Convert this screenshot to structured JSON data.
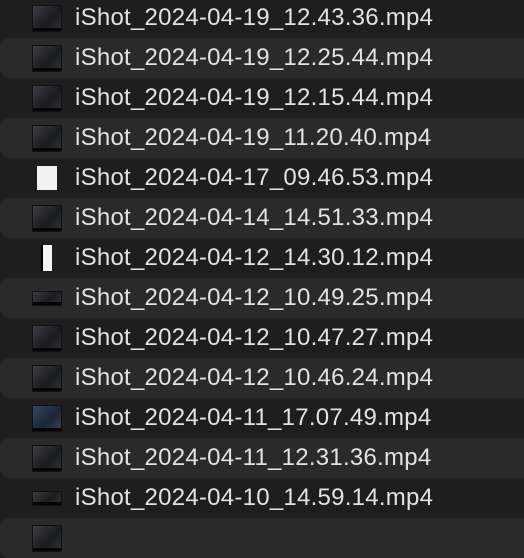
{
  "files": [
    {
      "name": "iShot_2024-04-19_12.43.36.mp4",
      "thumb": "square"
    },
    {
      "name": "iShot_2024-04-19_12.25.44.mp4",
      "thumb": "square"
    },
    {
      "name": "iShot_2024-04-19_12.15.44.mp4",
      "thumb": "square"
    },
    {
      "name": "iShot_2024-04-19_11.20.40.mp4",
      "thumb": "square"
    },
    {
      "name": "iShot_2024-04-17_09.46.53.mp4",
      "thumb": "doc"
    },
    {
      "name": "iShot_2024-04-14_14.51.33.mp4",
      "thumb": "square"
    },
    {
      "name": "iShot_2024-04-12_14.30.12.mp4",
      "thumb": "tall"
    },
    {
      "name": "iShot_2024-04-12_10.49.25.mp4",
      "thumb": "wide"
    },
    {
      "name": "iShot_2024-04-12_10.47.27.mp4",
      "thumb": "square"
    },
    {
      "name": "iShot_2024-04-12_10.46.24.mp4",
      "thumb": "square"
    },
    {
      "name": "iShot_2024-04-11_17.07.49.mp4",
      "thumb": "blue"
    },
    {
      "name": "iShot_2024-04-11_12.31.36.mp4",
      "thumb": "square"
    },
    {
      "name": "iShot_2024-04-10_14.59.14.mp4",
      "thumb": "wide"
    },
    {
      "name": "",
      "thumb": "square"
    }
  ]
}
